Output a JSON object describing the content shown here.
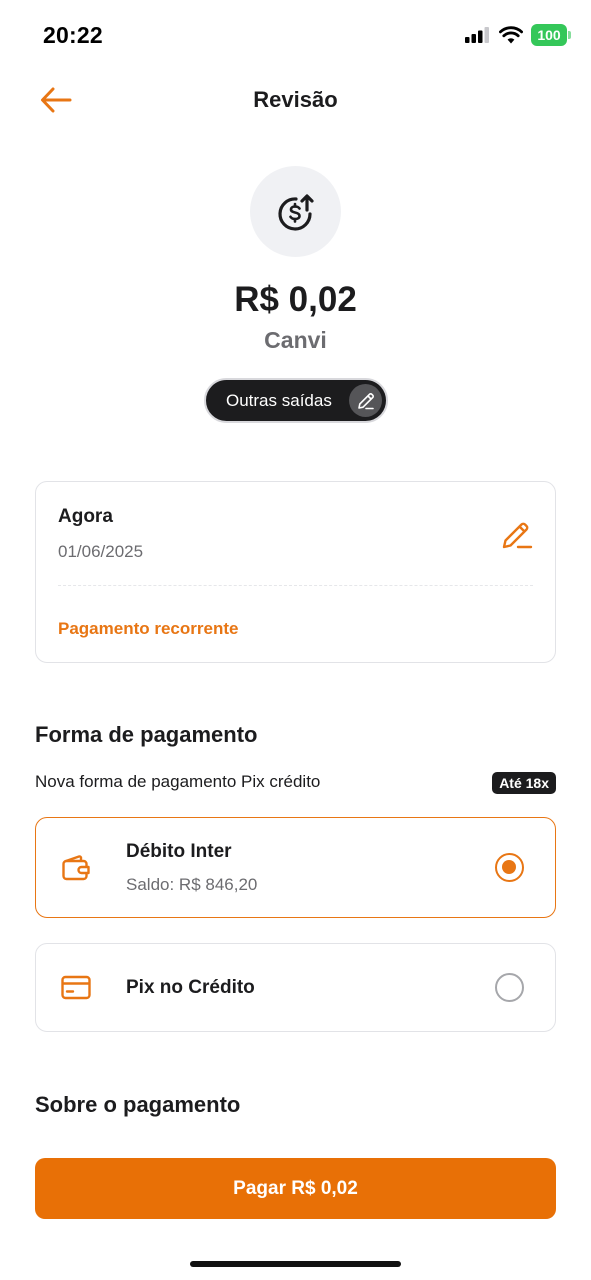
{
  "status_bar": {
    "time": "20:22",
    "battery": "100"
  },
  "header": {
    "title": "Revisão"
  },
  "transfer": {
    "amount": "R$ 0,02",
    "recipient": "Canvi",
    "category": "Outras saídas"
  },
  "schedule": {
    "when": "Agora",
    "date": "01/06/2025",
    "recurring_label": "Pagamento recorrente"
  },
  "payment_method": {
    "section_title": "Forma de pagamento",
    "pix_note": "Nova forma de pagamento Pix crédito",
    "installments_badge": "Até 18x",
    "options": [
      {
        "title": "Débito Inter",
        "subtitle": "Saldo: R$ 846,20",
        "icon": "wallet-icon",
        "selected": true
      },
      {
        "title": "Pix no Crédito",
        "icon": "credit-card-icon",
        "selected": false
      }
    ]
  },
  "about": {
    "section_title": "Sobre o pagamento"
  },
  "cta": {
    "label": "Pagar R$ 0,02"
  },
  "colors": {
    "accent": "#e87614",
    "cta": "#e87006",
    "battery": "#34c759"
  }
}
